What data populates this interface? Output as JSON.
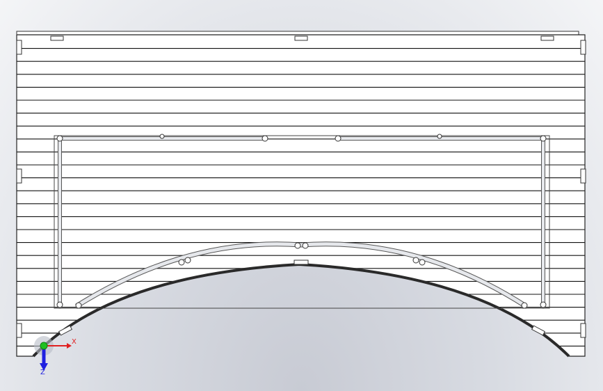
{
  "viewport": {
    "background_top": "#f4f5f7",
    "background_bottom": "#c8cbd4"
  },
  "triad": {
    "x_label": "X",
    "z_label": "Z",
    "x_color": "#e02020",
    "y_color": "#20c020",
    "z_color": "#2020e0"
  }
}
